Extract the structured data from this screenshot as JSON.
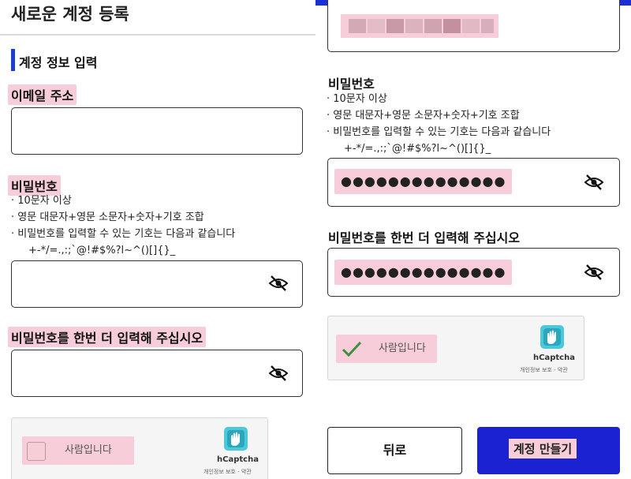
{
  "left": {
    "title": "새로운 계정 등록",
    "section_title": "계정 정보 입력",
    "email": {
      "label": "이메일 주소",
      "value": ""
    },
    "password": {
      "label": "비밀번호",
      "rules": [
        "· 10문자 이상",
        "· 영문 대문자+영문 소문자+숫자+기호 조합",
        "· 비밀번호를 입력할 수 있는 기호는 다음과 같습니다"
      ],
      "symbols": "+-*/=.,:;`@!#$%?l~^()[]{}_",
      "value": ""
    },
    "password_confirm": {
      "label": "비밀번호를 한번 더 입력해 주십시오",
      "value": ""
    },
    "captcha": {
      "label": "사람입니다",
      "brand": "hCaptcha",
      "links": "개인정보 보호 - 약관",
      "checked": false
    }
  },
  "right": {
    "password": {
      "label": "비밀번호",
      "rules": [
        "· 10문자 이상",
        "· 영문 대문자+영문 소문자+숫자+기호 조합",
        "· 비밀번호를 입력할 수 있는 기호는 다음과 같습니다"
      ],
      "symbols": "+-*/=.,:;`@!#$%?l~^()[]{}_",
      "masked_value": "●●●●●●●●●●●●●●"
    },
    "password_confirm": {
      "label": "비밀번호를 한번 더 입력해 주십시오",
      "masked_value": "●●●●●●●●●●●●●●"
    },
    "captcha": {
      "label": "사람입니다",
      "brand": "hCaptcha",
      "links": "개인정보 보호 - 약관",
      "checked": true
    },
    "buttons": {
      "back": "뒤로",
      "create": "계정 만들기"
    }
  },
  "colors": {
    "accent": "#1a22d2",
    "highlight": "#f6cdd8",
    "border": "#333333",
    "check": "#3e8e3e"
  },
  "icons": [
    "eye-off-icon",
    "hcaptcha-logo-icon",
    "check-icon"
  ]
}
